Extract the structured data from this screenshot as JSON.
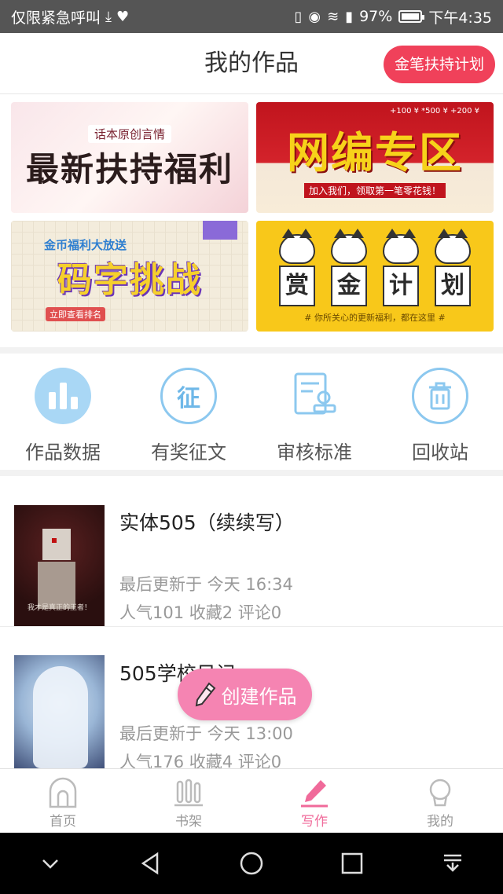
{
  "status_bar": {
    "left_text": "仅限紧急呼叫",
    "battery": "97%",
    "time": "下午4:35"
  },
  "header": {
    "title": "我的作品",
    "plan_button": "金笔扶持计划"
  },
  "banners": {
    "b1_small": "话本原创言情",
    "b1_big": "最新扶持福利",
    "b2_big": "网编专区",
    "b2_small": "加入我们，领取第一笔零花钱！",
    "b2_nums": "+100 ¥   *500 ¥   +200 ¥",
    "b3_small": "金币福利大放送",
    "b3_big": "码字挑战",
    "b3_link": "立即查看排名",
    "b4_chars": [
      "赏",
      "金",
      "计",
      "划"
    ],
    "b4_small": "# 你所关心的更新福利，都在这里 #"
  },
  "tools": [
    {
      "label": "作品数据"
    },
    {
      "label": "有奖征文",
      "glyph": "征"
    },
    {
      "label": "审核标准"
    },
    {
      "label": "回收站"
    }
  ],
  "works": [
    {
      "title": "实体505（续续写）",
      "updated": "最后更新于 今天 16:34",
      "stats": "人气101 收藏2 评论0",
      "cover_caption": "我才是真正的王者！"
    },
    {
      "title": "505学校日记",
      "updated": "最后更新于 今天 13:00",
      "stats": "人气176 收藏4 评论0"
    }
  ],
  "fab": {
    "label": "创建作品"
  },
  "tabbar": [
    {
      "label": "首页",
      "icon": "home-icon"
    },
    {
      "label": "书架",
      "icon": "bookshelf-icon"
    },
    {
      "label": "写作",
      "icon": "pencil-icon",
      "active": true
    },
    {
      "label": "我的",
      "icon": "profile-icon"
    }
  ],
  "colors": {
    "accent_pink": "#f06a9a",
    "plan_red": "#f0415a",
    "icon_blue": "#8cc8ef"
  }
}
